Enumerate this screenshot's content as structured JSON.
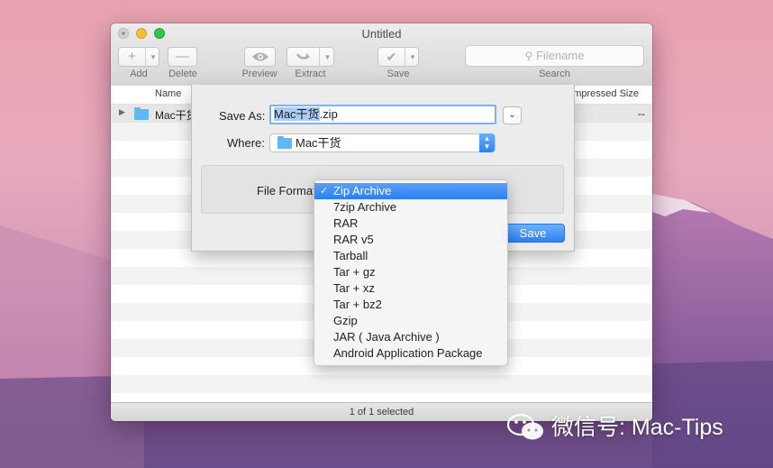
{
  "window": {
    "title": "Untitled",
    "toolbar": {
      "add_label": "Add",
      "delete_label": "Delete",
      "preview_label": "Preview",
      "extract_label": "Extract",
      "save_label": "Save",
      "search_label": "Search",
      "search_placeholder": "Filename"
    },
    "columns": {
      "name": "Name",
      "compressed_size": "mpressed Size"
    },
    "rows": [
      {
        "name": "Mac干货",
        "compressed_size": "--"
      }
    ],
    "status": "1 of 1 selected"
  },
  "save_sheet": {
    "save_as_label": "Save As:",
    "filename_selected": "Mac干货",
    "filename_ext": ".zip",
    "where_label": "Where:",
    "where_value": "Mac干货",
    "file_format_label": "File Format",
    "save_button": "Save"
  },
  "format_menu": {
    "selected_index": 0,
    "items": [
      "Zip Archive",
      "7zip Archive",
      "RAR",
      "RAR v5",
      "Tarball",
      "Tar + gz",
      "Tar + xz",
      "Tar + bz2",
      "Gzip",
      "JAR ( Java Archive )",
      "Android Application Package"
    ]
  },
  "watermark": {
    "text": "微信号: Mac-Tips"
  },
  "colors": {
    "accent": "#2f80f2",
    "folder": "#5fb8f1"
  }
}
